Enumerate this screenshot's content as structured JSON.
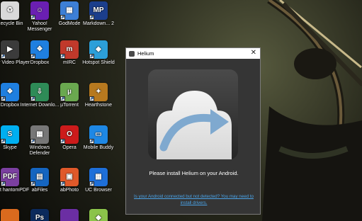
{
  "desktop": {
    "icons": [
      {
        "label": "Recycle Bin",
        "icon": "recycle-bin-icon",
        "color": "#d9d9d9",
        "glyph": "♻"
      },
      {
        "label": "Yahoo! Messenger",
        "icon": "yahoo-messenger-icon",
        "color": "#6a1fb2",
        "glyph": "☺"
      },
      {
        "label": "GodMode",
        "icon": "godmode-icon",
        "color": "#3d7fd6",
        "glyph": "▦"
      },
      {
        "label": "Markdown... 2",
        "icon": "markdownpad-icon",
        "color": "#1b3e8c",
        "glyph": "MP"
      },
      {
        "label": "Acer Video Player",
        "icon": "acer-video-player-icon",
        "color": "#3b3b3b",
        "glyph": "▶"
      },
      {
        "label": "Dropbox",
        "icon": "dropbox-icon",
        "color": "#1f7fe0",
        "glyph": "❖"
      },
      {
        "label": "mIRC",
        "icon": "mirc-icon",
        "color": "#c0392b",
        "glyph": "m"
      },
      {
        "label": "Hotspot Shield",
        "icon": "hotspot-shield-icon",
        "color": "#2c9fd9",
        "glyph": "◆"
      },
      {
        "label": "Dropbox",
        "icon": "dropbox-icon",
        "color": "#1f7fe0",
        "glyph": "❖"
      },
      {
        "label": "Internet Downlo...",
        "icon": "internet-download-manager-icon",
        "color": "#2e8b57",
        "glyph": "⇩"
      },
      {
        "label": "µTorrent",
        "icon": "utorrent-icon",
        "color": "#6aa84f",
        "glyph": "µ"
      },
      {
        "label": "Hearthstone",
        "icon": "hearthstone-icon",
        "color": "#b7791f",
        "glyph": "✦"
      },
      {
        "label": "Skype",
        "icon": "skype-icon",
        "color": "#00aff0",
        "glyph": "S"
      },
      {
        "label": "Windows Defender",
        "icon": "windows-defender-icon",
        "color": "#777777",
        "glyph": "▦"
      },
      {
        "label": "Opera",
        "icon": "opera-icon",
        "color": "#cc1b1b",
        "glyph": "O"
      },
      {
        "label": "Mobile Buddy",
        "icon": "mobile-buddy-icon",
        "color": "#1e88e5",
        "glyph": "▭"
      },
      {
        "label": "Foxit hantomPDF",
        "icon": "foxit-phantompdf-icon",
        "color": "#7b3fa0",
        "glyph": "PDF"
      },
      {
        "label": "abFiles",
        "icon": "abfiles-icon",
        "color": "#1565c0",
        "glyph": "▤"
      },
      {
        "label": "abPhoto",
        "icon": "abphoto-icon",
        "color": "#e0592a",
        "glyph": "▣"
      },
      {
        "label": "UC Browser",
        "icon": "uc-browser-icon",
        "color": "#1e6fd9",
        "glyph": "▦"
      },
      {
        "label": "",
        "icon": "app-icon",
        "color": "#d96a1e",
        "glyph": ""
      },
      {
        "label": "",
        "icon": "photoshop-icon",
        "color": "#0b2a5c",
        "glyph": "Ps"
      },
      {
        "label": "",
        "icon": "app-icon",
        "color": "#6b2ea3",
        "glyph": ""
      },
      {
        "label": "",
        "icon": "bluestacks-icon",
        "color": "#8bc34a",
        "glyph": "◆"
      }
    ]
  },
  "window": {
    "title": "Helium",
    "close_glyph": "✕",
    "message": "Please install Helium on your Android.",
    "link": "Is your Android connected but not detected? You may need to install drivers."
  }
}
